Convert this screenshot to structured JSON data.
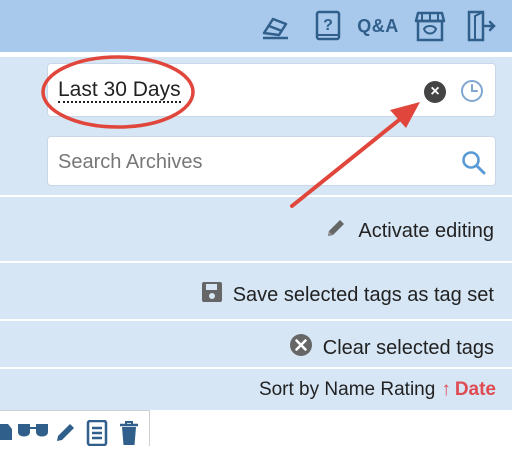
{
  "header": {
    "icons": [
      "eraser-icon",
      "help-icon",
      "qa-icon",
      "store-icon",
      "logout-icon"
    ],
    "qa_label": "Q&A"
  },
  "filters": {
    "date_range_value": "Last 30 Days",
    "search_placeholder": "Search Archives"
  },
  "actions": {
    "activate_editing": "Activate editing",
    "save_tags": "Save selected tags as tag set",
    "clear_tags": "Clear selected tags"
  },
  "sort": {
    "label": "Sort by",
    "options": [
      "Name",
      "Rating",
      "Date"
    ],
    "active": "Date",
    "direction_symbol": "↑"
  },
  "colors": {
    "topbar": "#a9c9ec",
    "panel": "#d6e6f5",
    "accent_red": "#e04b53",
    "icon_blue": "#2f5f8a"
  }
}
